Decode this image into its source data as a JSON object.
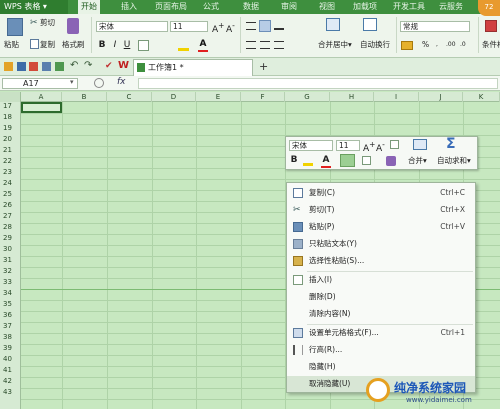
{
  "menu": {
    "app": "WPS 表格",
    "tabs": [
      "开始",
      "插入",
      "页面布局",
      "公式",
      "数据",
      "审阅",
      "视图",
      "加载项",
      "开发工具",
      "云服务"
    ],
    "active_tab": "开始"
  },
  "ribbon": {
    "paste": "粘贴",
    "cut": "剪切",
    "copy": "复制",
    "format_painter": "格式刷",
    "font": "宋体",
    "font_size": "11",
    "merge_center": "合并居中",
    "auto_wrap": "自动换行",
    "number_format": "常规",
    "percent": "%",
    "conditional_format": "条件格"
  },
  "doc_tab": {
    "title": "工作簿1 *",
    "add": "+"
  },
  "formula_bar": {
    "cell_ref": "A17",
    "fx": "fx"
  },
  "columns": [
    "A",
    "B",
    "C",
    "D",
    "E",
    "F",
    "G",
    "H",
    "I",
    "J",
    "K"
  ],
  "rows": [
    "17",
    "18",
    "19",
    "20",
    "21",
    "22",
    "23",
    "24",
    "25",
    "26",
    "27",
    "28",
    "29",
    "30",
    "31",
    "32",
    "33",
    "34",
    "35",
    "36",
    "37",
    "38",
    "39",
    "40",
    "41",
    "42",
    "43"
  ],
  "mini_toolbar": {
    "font": "宋体",
    "size": "11",
    "bold": "B",
    "font_color": "A",
    "merge": "合并",
    "autosum": "自动求和"
  },
  "context_menu": {
    "items": [
      {
        "label": "复制(C)",
        "shortcut": "Ctrl+C",
        "icon": "copy-icon"
      },
      {
        "label": "剪切(T)",
        "shortcut": "Ctrl+X",
        "icon": "scissors-icon"
      },
      {
        "label": "粘贴(P)",
        "shortcut": "Ctrl+V",
        "icon": "paste-icon"
      },
      {
        "label": "只粘贴文本(Y)",
        "shortcut": "",
        "icon": "paste-text-icon"
      },
      {
        "label": "选择性粘贴(S)...",
        "shortcut": "",
        "icon": "paste-special-icon"
      },
      {
        "label": "插入(I)",
        "shortcut": "",
        "icon": "insert-icon"
      },
      {
        "label": "删除(D)",
        "shortcut": "",
        "icon": ""
      },
      {
        "label": "清除内容(N)",
        "shortcut": "",
        "icon": ""
      },
      {
        "label": "设置单元格格式(F)...",
        "shortcut": "Ctrl+1",
        "icon": "format-cells-icon"
      },
      {
        "label": "行高(R)...",
        "shortcut": "",
        "icon": "row-height-icon"
      },
      {
        "label": "隐藏(H)",
        "shortcut": "",
        "icon": ""
      },
      {
        "label": "取消隐藏(U)",
        "shortcut": "",
        "icon": ""
      }
    ]
  },
  "badge": {
    "number": "72"
  },
  "watermark": {
    "title": "纯净系统家园",
    "url": "www.yidaimei.com"
  },
  "colors": {
    "accent": "#3e8f3e",
    "grid_bg": "#c7e8c0"
  }
}
